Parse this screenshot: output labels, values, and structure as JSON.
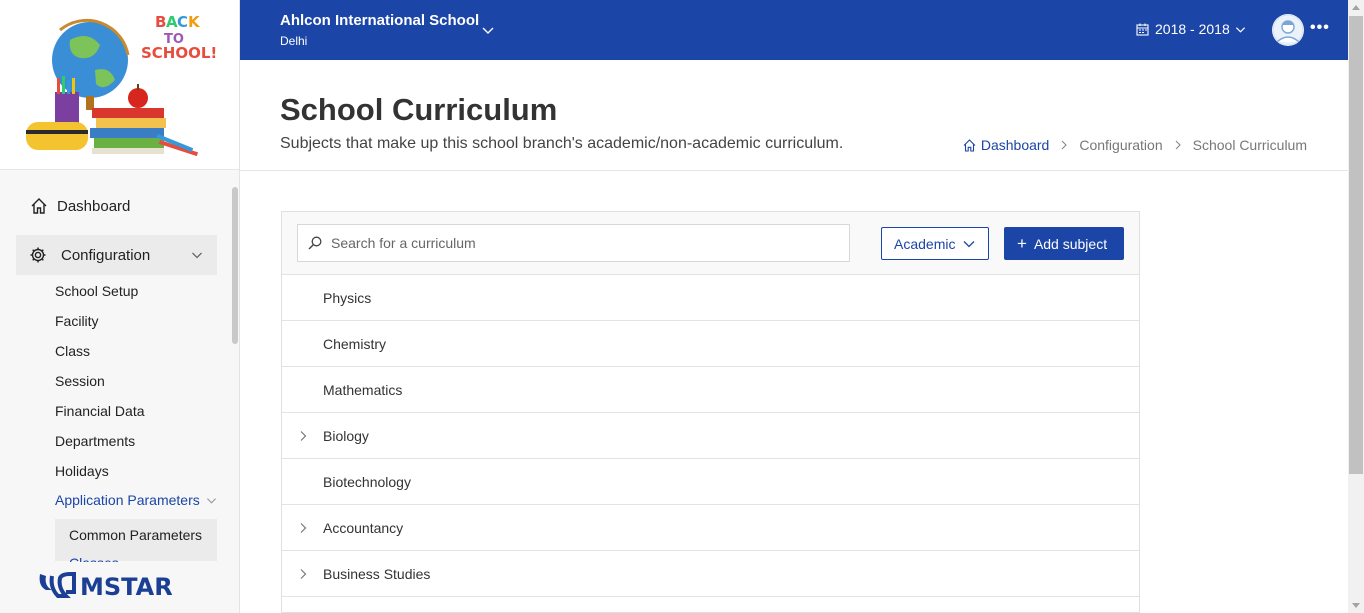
{
  "sidebar": {
    "logo_text": "BACK TO SCHOOL!",
    "dashboard_label": "Dashboard",
    "configuration_label": "Configuration",
    "config_items": [
      "School Setup",
      "Facility",
      "Class",
      "Session",
      "Financial Data",
      "Departments",
      "Holidays"
    ],
    "app_params_label": "Application Parameters",
    "common_params_label": "Common Parameters",
    "classes_label": "Classes",
    "brand": "MSTAR"
  },
  "header": {
    "school_name": "Ahlcon International School",
    "school_city": "Delhi",
    "year": "2018 - 2018",
    "more": "•••"
  },
  "page": {
    "title": "School Curriculum",
    "subtitle": "Subjects that make up this school branch's academic/non-academic curriculum."
  },
  "breadcrumb": {
    "home": "Dashboard",
    "section": "Configuration",
    "current": "School Curriculum"
  },
  "toolbar": {
    "search_placeholder": "Search for a curriculum",
    "filter_label": "Academic",
    "add_label": "Add subject",
    "add_symbol": "+"
  },
  "subjects": [
    {
      "name": "Physics",
      "expandable": false
    },
    {
      "name": "Chemistry",
      "expandable": false
    },
    {
      "name": "Mathematics",
      "expandable": false
    },
    {
      "name": "Biology",
      "expandable": true
    },
    {
      "name": "Biotechnology",
      "expandable": false
    },
    {
      "name": "Accountancy",
      "expandable": true
    },
    {
      "name": "Business Studies",
      "expandable": true
    }
  ],
  "colors": {
    "primary": "#1b45a6",
    "sidebar_bg": "#f7f7f7",
    "active_bg": "#ebebeb"
  }
}
